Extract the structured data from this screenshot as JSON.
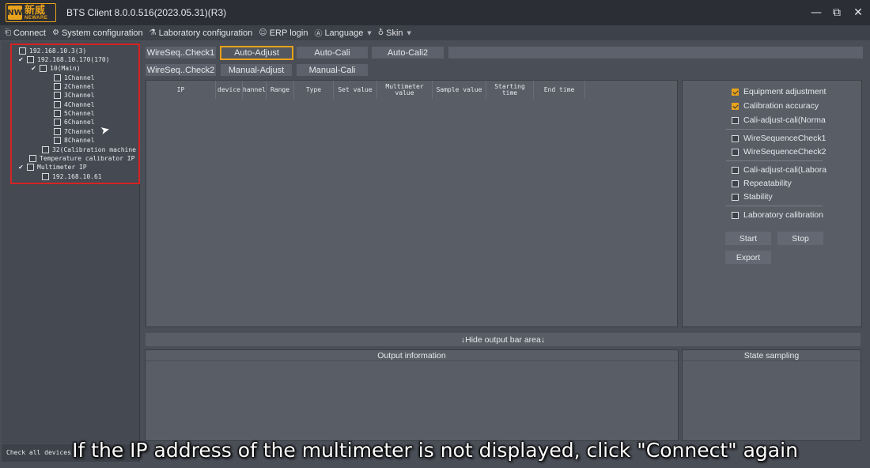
{
  "titlebar": {
    "logo_mark": "NW",
    "logo_cn": "新威",
    "logo_en": "NEWARE",
    "title": "BTS Client 8.0.0.516(2023.05.31)(R3)",
    "minimize": "—",
    "restore": "⧉",
    "close": "✕"
  },
  "menubar": {
    "connect": "Connect",
    "system_config": "System configuration",
    "lab_config": "Laboratory configuration",
    "erp_login": "ERP login",
    "language": "Language",
    "skin": "Skin"
  },
  "tree": [
    {
      "label": "192.168.10.3(3)"
    },
    {
      "label": "192.168.10.170(170)"
    },
    {
      "label": "10(Main)"
    },
    {
      "label": "1Channel"
    },
    {
      "label": "2Channel"
    },
    {
      "label": "3Channel"
    },
    {
      "label": "4Channel"
    },
    {
      "label": "5Channel"
    },
    {
      "label": "6Channel"
    },
    {
      "label": "7Channel"
    },
    {
      "label": "8Channel"
    },
    {
      "label": "32(Calibration machine"
    },
    {
      "label": "Temperature calibrator IP"
    },
    {
      "label": "Multimeter IP"
    },
    {
      "label": "192.168.10.61"
    }
  ],
  "status": {
    "left": "Check all devices"
  },
  "tabs": {
    "wireseq1": "WireSeq..Check1",
    "auto_adjust": "Auto-Adjust",
    "auto_cali": "Auto-Cali",
    "auto_cali2": "Auto-Cali2",
    "wireseq2": "WireSeq..Check2",
    "manual_adjust": "Manual-Adjust",
    "manual_cali": "Manual-Cali"
  },
  "table": {
    "columns": [
      "IP",
      "device",
      "hannel",
      "Range",
      "Type",
      "Set value",
      "Multimeter value",
      "Sample value",
      "Starting time",
      "End time"
    ]
  },
  "options": {
    "equipment_adjustment": "Equipment adjustment",
    "calibration_accuracy": "Calibration accuracy",
    "cali_adjust_cali_normal": "Cali-adjust-cali(Norma",
    "wiresequencecheck1": "WireSequenceCheck1",
    "wiresequencecheck2": "WireSequenceCheck2",
    "cali_adjust_cali_lab": "Cali-adjust-cali(Labora",
    "repeatability": "Repeatability",
    "stability": "Stability",
    "laboratory_calibration": "Laboratory calibration"
  },
  "actions": {
    "start": "Start",
    "stop": "Stop",
    "export": "Export"
  },
  "output": {
    "hide_bar": "↓Hide output bar area↓",
    "output_information": "Output information",
    "state_sampling": "State sampling"
  },
  "caption": "If the IP address of the multimeter is not displayed, click \"Connect\" again",
  "colors": {
    "accent": "#e8a21b",
    "highlight": "#d42424"
  }
}
